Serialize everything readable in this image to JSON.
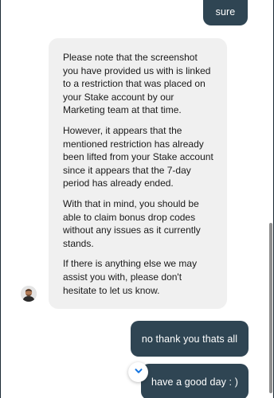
{
  "conversation": {
    "user_messages": [
      {
        "text": "sure"
      },
      {
        "text": "no thank you thats all"
      },
      {
        "text": "have a good day : )"
      }
    ],
    "agent_message": {
      "paragraphs": [
        "Please note that the screenshot you have provided us with is linked to a restriction that was placed on your Stake account by our Marketing team at that time.",
        "However, it appears that the mentioned restriction has already been lifted from your Stake account since it appears that the 7-day period has already ended.",
        "With that in mind, you should be able to claim bonus drop codes without any issues as it currently stands.",
        "If there is anything else we may assist you with, please don't hesitate to let us know."
      ]
    }
  },
  "icons": {
    "scroll_down": "chevron-down-icon",
    "agent_avatar": "agent-avatar"
  },
  "colors": {
    "user_bubble": "#2f4553",
    "agent_bubble": "#f0f0f0",
    "scroll_chevron": "#1475e1"
  }
}
